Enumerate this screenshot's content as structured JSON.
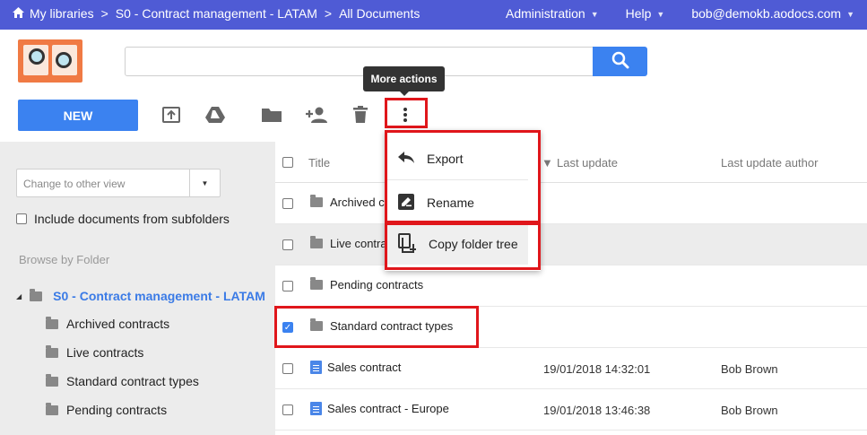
{
  "topbar": {
    "breadcrumbs": [
      "My libraries",
      "S0 - Contract management - LATAM",
      "All Documents"
    ],
    "admin_label": "Administration",
    "help_label": "Help",
    "user_label": "bob@demokb.aodocs.com"
  },
  "search": {
    "placeholder": ""
  },
  "toolbar": {
    "new_label": "NEW",
    "tooltip": "More actions"
  },
  "left_panel": {
    "view_placeholder": "Change to other view",
    "include_label": "Include documents from subfolders",
    "browse_label": "Browse by Folder",
    "root_folder": "S0 - Contract management - LATAM",
    "folders": [
      "Archived contracts",
      "Live contracts",
      "Standard contract types",
      "Pending contracts"
    ]
  },
  "list": {
    "columns": {
      "title": "Title",
      "last_update": "Last update",
      "author": "Last update author"
    },
    "rows": [
      {
        "title": "Archived c",
        "type": "folder",
        "date": "",
        "author": "",
        "checked": false
      },
      {
        "title": "Live contra",
        "type": "folder",
        "date": "",
        "author": "",
        "checked": false
      },
      {
        "title": "Pending contracts",
        "type": "folder",
        "date": "",
        "author": "",
        "checked": false
      },
      {
        "title": "Standard contract types",
        "type": "folder",
        "date": "",
        "author": "",
        "checked": true
      },
      {
        "title": "Sales contract",
        "type": "doc",
        "date": "19/01/2018 14:32:01",
        "author": "Bob Brown",
        "checked": false
      },
      {
        "title": "Sales contract - Europe",
        "type": "doc",
        "date": "19/01/2018 13:46:38",
        "author": "Bob Brown",
        "checked": false
      }
    ]
  },
  "menu": {
    "export_label": "Export",
    "rename_label": "Rename",
    "copy_label": "Copy folder tree"
  },
  "colors": {
    "accent": "#3b82f0",
    "topbar": "#4f5bd5",
    "highlight": "#e0161b"
  }
}
